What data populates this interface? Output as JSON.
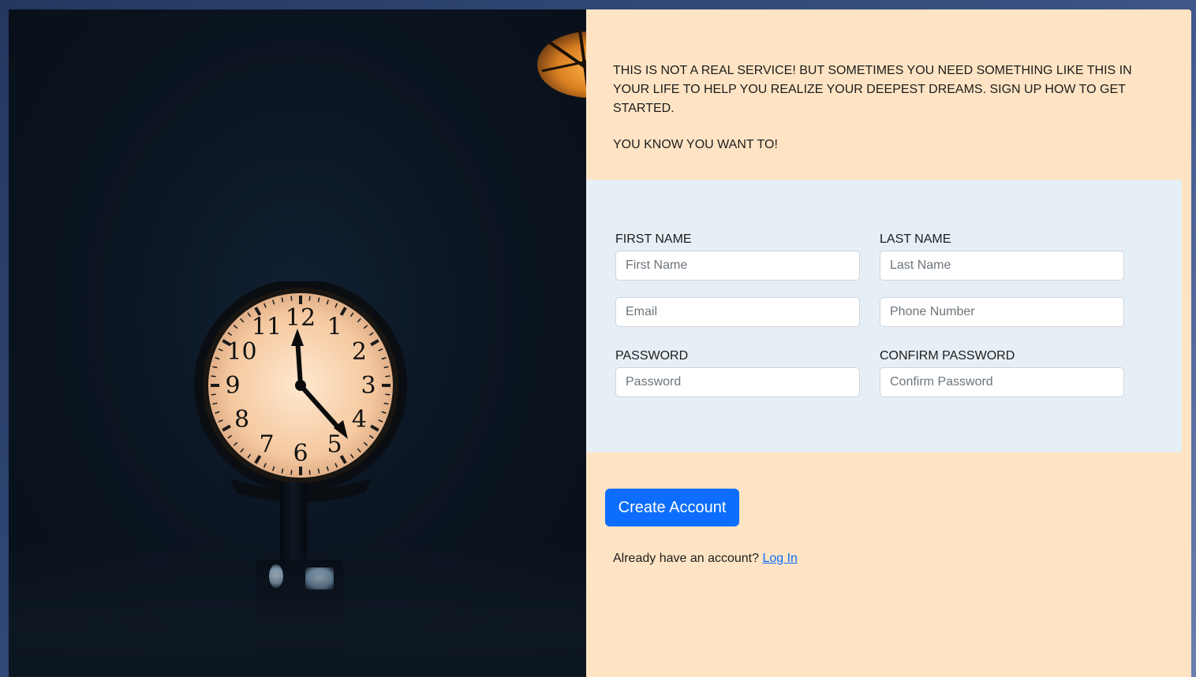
{
  "intro": {
    "paragraph": "THIS IS NOT A REAL SERVICE! BUT SOMETIMES YOU NEED SOMETHING LIKE THIS IN YOUR LIFE TO HELP YOU REALIZE YOUR DEEPEST DREAMS. SIGN UP HOW TO GET STARTED.",
    "tagline": "YOU KNOW YOU WANT TO!"
  },
  "form": {
    "first_name": {
      "label": "FIRST NAME",
      "placeholder": "First Name",
      "value": ""
    },
    "last_name": {
      "label": "LAST NAME",
      "placeholder": "Last Name",
      "value": ""
    },
    "email": {
      "placeholder": "Email",
      "value": ""
    },
    "phone": {
      "placeholder": "Phone Number",
      "value": ""
    },
    "password": {
      "label": "PASSWORD",
      "placeholder": "Password",
      "value": ""
    },
    "confirm_password": {
      "label": "CONFIRM PASSWORD",
      "placeholder": "Confirm Password",
      "value": ""
    }
  },
  "actions": {
    "create_label": "Create Account",
    "login_prompt": "Already have an account?",
    "login_link": "Log In"
  },
  "photo": {
    "clock_numerals": [
      "12",
      "1",
      "2",
      "3",
      "4",
      "5",
      "6",
      "7",
      "8",
      "9",
      "10",
      "11"
    ]
  },
  "colors": {
    "panel_background": "#fee4c4",
    "form_background": "#e6eff5",
    "primary": "#0d6efd",
    "photo_background": "#0b1420"
  }
}
